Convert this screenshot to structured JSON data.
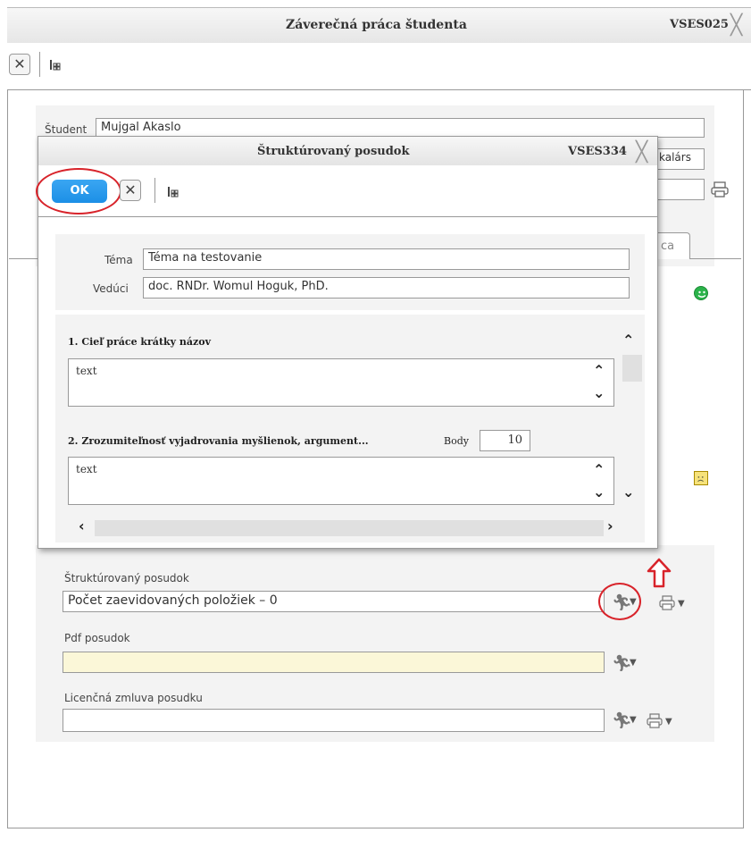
{
  "main_window": {
    "title": "Záverečná práca študenta",
    "code": "VSES025",
    "student_label": "Študent",
    "student_value": "Mujgal Akaslo",
    "partial_right_text": "kalárs",
    "partial_tab_text": "ca"
  },
  "dialog": {
    "title": "Štruktúrovaný posudok",
    "code": "VSES334",
    "ok_label": "OK",
    "tema_label": "Téma",
    "tema_value": "Téma na testovanie",
    "veduci_label": "Vedúci",
    "veduci_value": "doc. RNDr. Womul Hoguk, PhD.",
    "sections": [
      {
        "heading": "1. Cieľ práce krátky názov",
        "text": "text"
      },
      {
        "heading": "2. Zrozumiteľnosť vyjadrovania myšlienok, argument...",
        "text": "text",
        "body_label": "Body",
        "body_value": "10"
      }
    ]
  },
  "lower": {
    "struct_label": "Štruktúrovaný posudok",
    "struct_value": "Počet zaevidovaných položiek – 0",
    "pdf_label": "Pdf posudok",
    "pdf_value": "",
    "license_label": "Licenčná zmluva posudku",
    "license_value": ""
  },
  "colors": {
    "ok_button": "#1c8fe6",
    "highlight_red": "#d8232a",
    "pdf_field": "#fbf7d8",
    "panel_bg": "#f3f3f3"
  }
}
